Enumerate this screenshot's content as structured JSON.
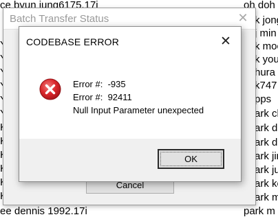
{
  "background": {
    "left_lines": [
      "ce byun jung6175.17i",
      "Y",
      "Y",
      "Y",
      "Y",
      "Y",
      "Y",
      "K",
      "K",
      "K",
      "K",
      "K",
      "K",
      "K",
      "K",
      "K",
      "ee dennis 1992.17i"
    ],
    "right_lines": [
      "oh doh",
      "k jong",
      "j min",
      "k moc",
      "k your",
      "hura",
      "k747",
      "pps",
      "ark ch",
      "ark da",
      "ark do",
      "ark jin",
      "ark jun",
      "ark ko",
      "ark m",
      "park m"
    ]
  },
  "batch_window": {
    "title": "Batch Transfer Status",
    "close_glyph": "✕",
    "cancel_label": "Cancel"
  },
  "dialog": {
    "title": "CODEBASE ERROR",
    "close_glyph": "✕",
    "line1": "Error #:  -935",
    "line2": "Error #:  92411",
    "line3": "Null Input Parameter unexpected",
    "ok_label": "OK",
    "icon": "error-icon",
    "icon_color": "#d9262b"
  }
}
